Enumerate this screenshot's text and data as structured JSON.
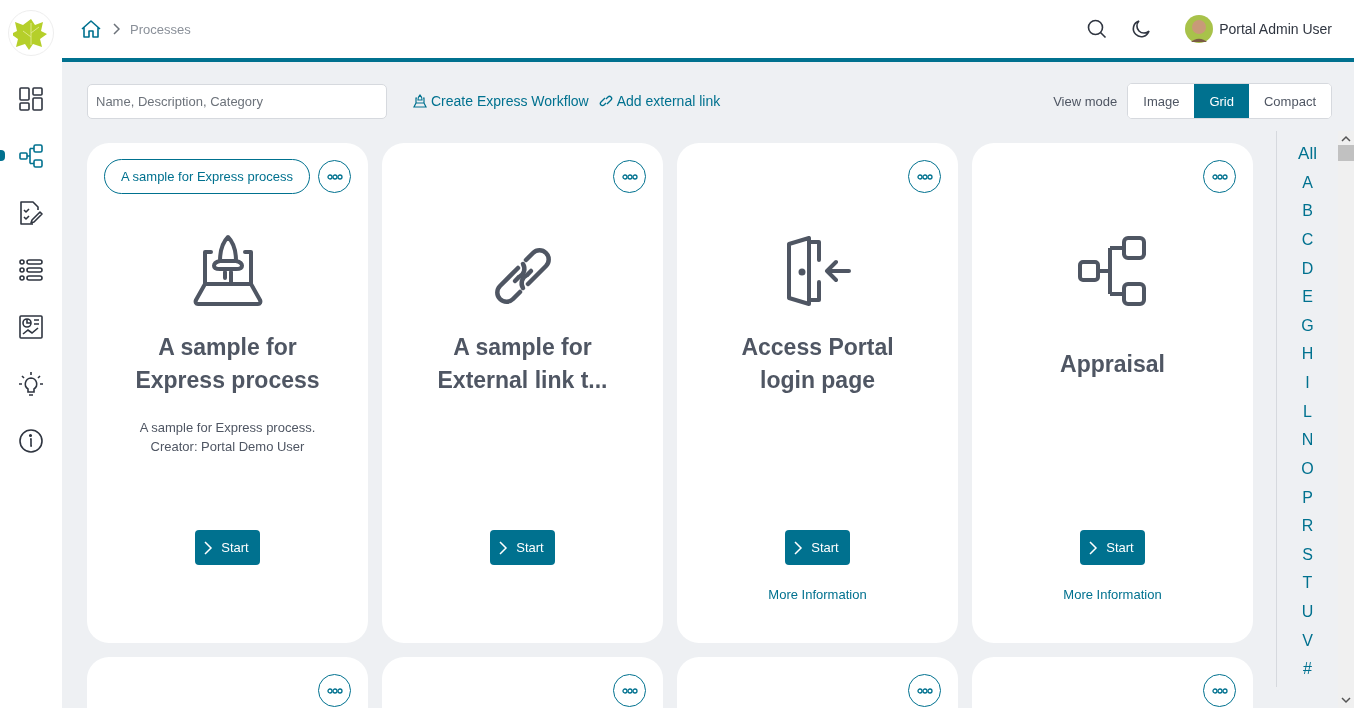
{
  "sidebar": {
    "items": [
      {
        "selected": false
      },
      {
        "selected": true
      },
      {
        "selected": false
      },
      {
        "selected": false
      },
      {
        "selected": false
      },
      {
        "selected": false
      },
      {
        "selected": false
      }
    ]
  },
  "breadcrumb": {
    "current": "Processes"
  },
  "user": {
    "name": "Portal Admin User"
  },
  "toolbar": {
    "search": {
      "placeholder": "Name, Description, Category"
    },
    "actions": [
      "Create Express Workflow",
      "Add external link"
    ],
    "view_mode_label": "View mode",
    "view_modes": [
      {
        "label": "Image",
        "selected": false
      },
      {
        "label": "Grid",
        "selected": true
      },
      {
        "label": "Compact",
        "selected": false
      }
    ]
  },
  "cards": [
    {
      "kind": "express",
      "tag": "A sample for Express process",
      "title": "A sample for Express process",
      "description": "A sample for Express process.\nCreator: Portal Demo User",
      "start": "Start"
    },
    {
      "kind": "external-link",
      "title": "A sample for External link t...",
      "start": "Start"
    },
    {
      "kind": "login",
      "title": "Access Portal login page",
      "start": "Start",
      "more_info": "More Information"
    },
    {
      "kind": "process",
      "title": "Appraisal",
      "start": "Start",
      "more_info": "More Information"
    },
    {
      "kind": "partial"
    },
    {
      "kind": "partial"
    },
    {
      "kind": "partial"
    },
    {
      "kind": "partial"
    }
  ],
  "alphabet": [
    "All",
    "A",
    "B",
    "C",
    "D",
    "E",
    "G",
    "H",
    "I",
    "L",
    "N",
    "O",
    "P",
    "R",
    "S",
    "T",
    "U",
    "V",
    "#"
  ]
}
